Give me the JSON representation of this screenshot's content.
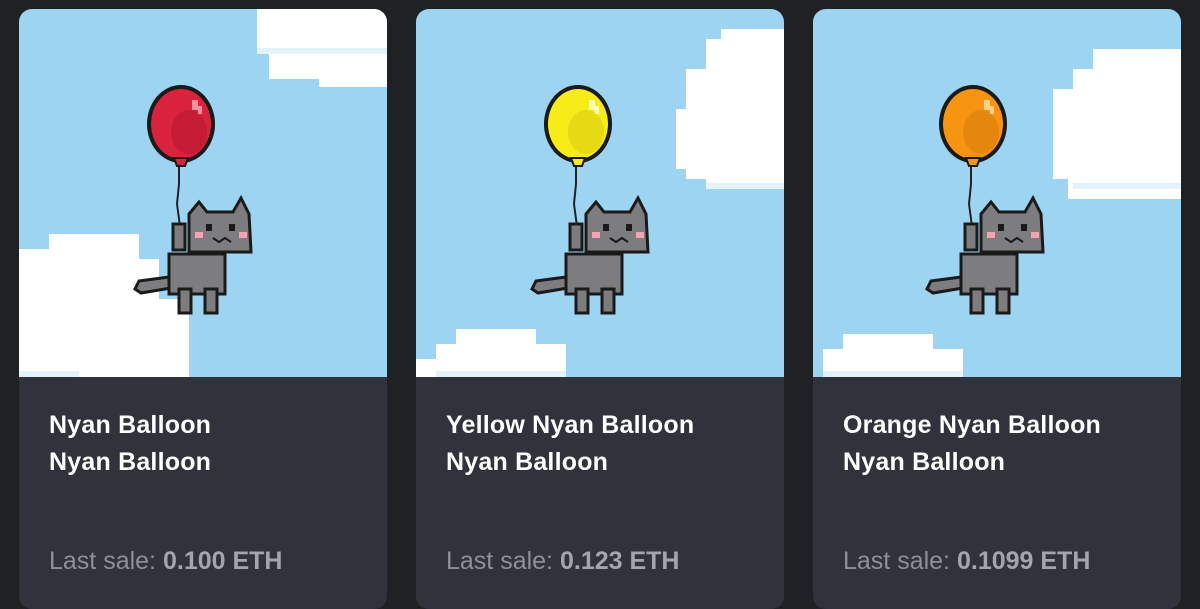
{
  "colors": {
    "page_background": "#202125",
    "card_background": "#30333c",
    "sky": "#9dd4f2",
    "cloud": "#ffffff",
    "cloud_shade": "#e3f2fb",
    "cat": "#7d7d80"
  },
  "cards": [
    {
      "name": "Nyan Balloon",
      "collection": "Nyan Balloon",
      "sale_label": "Last sale:",
      "sale_value": "0.100 ETH",
      "balloon_color": "#d9223b",
      "balloon_highlight": "#f2909c",
      "balloon_dark": "#9a1226",
      "art_icon": "cat-with-balloon-pixel-art"
    },
    {
      "name": "Yellow Nyan Balloon",
      "collection": "Nyan Balloon",
      "sale_label": "Last sale:",
      "sale_value": "0.123 ETH",
      "balloon_color": "#f6ec18",
      "balloon_highlight": "#fffbb0",
      "balloon_dark": "#c9ba0a",
      "art_icon": "cat-with-balloon-pixel-art"
    },
    {
      "name": "Orange Nyan Balloon",
      "collection": "Nyan Balloon",
      "sale_label": "Last sale:",
      "sale_value": "0.1099 ETH",
      "balloon_color": "#f79412",
      "balloon_highlight": "#ffd08a",
      "balloon_dark": "#c2700a",
      "art_icon": "cat-with-balloon-pixel-art"
    }
  ]
}
